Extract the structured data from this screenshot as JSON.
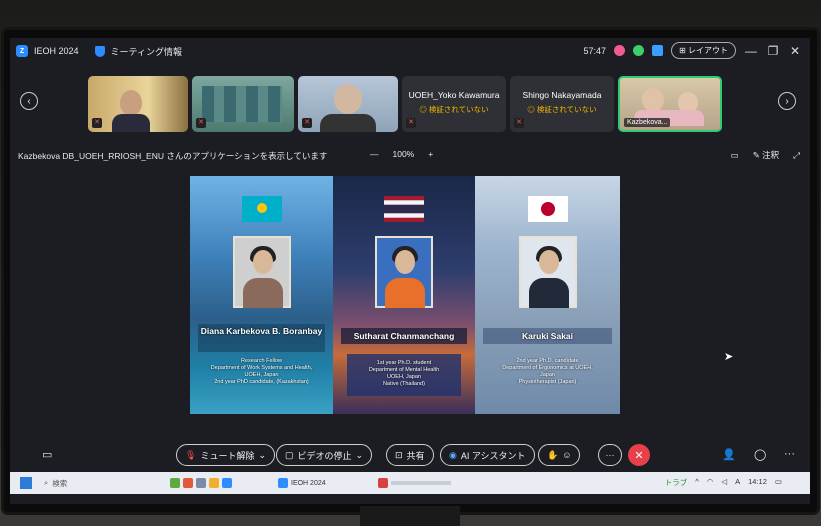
{
  "window": {
    "app_title": "IEOH 2024",
    "meeting_info": "ミーティング情報",
    "timer": "57:47",
    "layout_label": "レイアウト",
    "minimize": "—",
    "maximize": "❐",
    "close": "✕"
  },
  "participants": [
    {
      "name": "",
      "status": ""
    },
    {
      "name": "",
      "status": ""
    },
    {
      "name": "",
      "status": ""
    },
    {
      "name": "UOEH_Yoko Kawamura",
      "status": "◎ 検証されていない"
    },
    {
      "name": "Shingo Nakayamada",
      "status": "◎ 検証されていない"
    },
    {
      "name": "Kazbekova...",
      "status": ""
    }
  ],
  "share": {
    "message": "Kazbekova DB_UOEH_RRIOSH_ENU さんのアプリケーションを表示しています",
    "zoom_minus": "—",
    "zoom_level": "100%",
    "zoom_plus": "+",
    "annotate_label": "注釈"
  },
  "slide": {
    "people": [
      {
        "name": "Diana Karbekova B. Boranbay",
        "info": [
          "Research Fellow",
          "Department of Work Systems and Health,",
          "UOEH, Japan",
          "2nd year PhD candidate, (Kazakhstan)"
        ]
      },
      {
        "name": "Sutharat Chanmanchang",
        "info": [
          "1st year Ph.D. student",
          "Department of Mental Health",
          "UOEH, Japan",
          "Native (Thailand)"
        ]
      },
      {
        "name": "Karuki Sakai",
        "info": [
          "2nd year Ph.D. candidate",
          "Department of Ergonomics at UOEH,",
          "Japan",
          "Physiotherapist (Japan)"
        ]
      }
    ]
  },
  "toolbar": {
    "mute_label": "ミュート解除",
    "video_label": "ビデオの停止",
    "share_label": "共有",
    "ai_label": "AI アシスタント",
    "more": "···",
    "end": "✕"
  },
  "taskbar": {
    "search_label": "検索",
    "app1": "IEOH 2024",
    "tray_text": "トラブ",
    "ime": "A",
    "time": "14:12"
  },
  "colors": {
    "accent": "#2d8cff",
    "end_call": "#e8404a",
    "warning": "#f4b400"
  }
}
